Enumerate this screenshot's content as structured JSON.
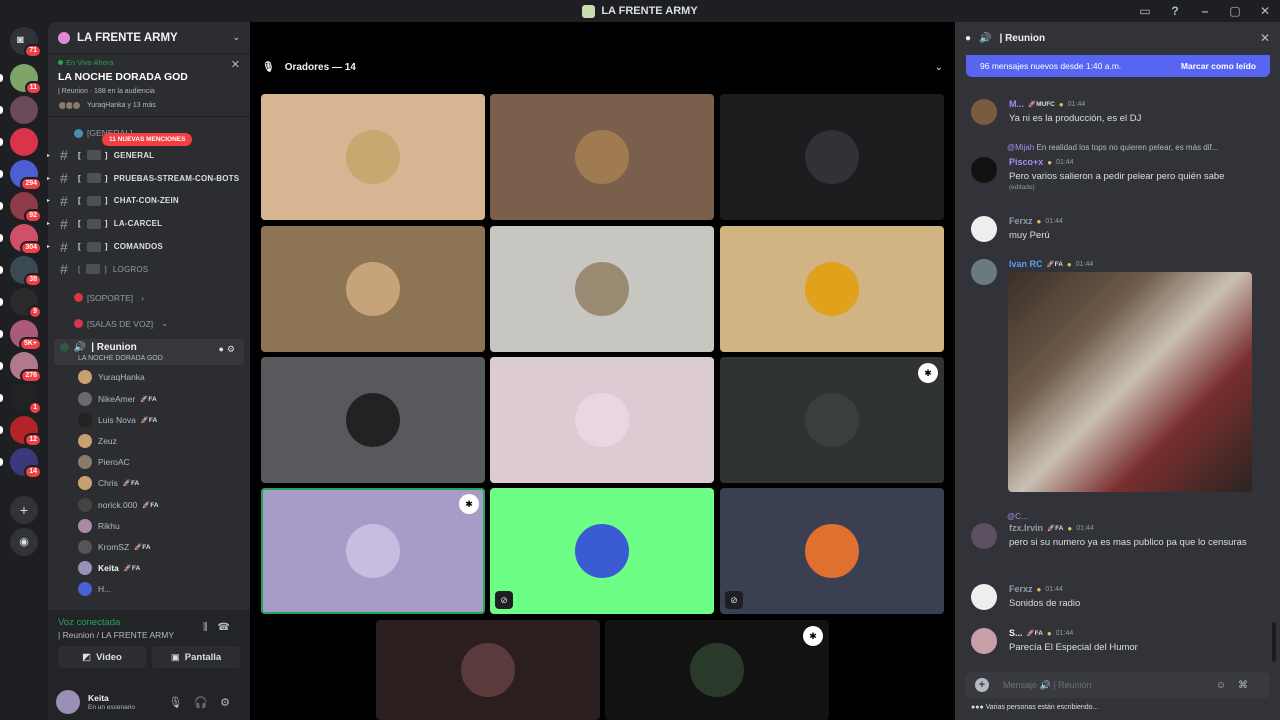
{
  "app": {
    "title": "LA FRENTE ARMY"
  },
  "titlebar": {
    "controls": [
      "inbox-icon",
      "help-icon",
      "minimize",
      "maximize",
      "close"
    ]
  },
  "rail": {
    "home_badge": "71",
    "servers": [
      {
        "badge": "11",
        "color": "#7fa46a"
      },
      {
        "badge": "",
        "color": "#6b4a5a"
      },
      {
        "badge": "",
        "color": "#d8354b"
      },
      {
        "badge": "294",
        "color": "#4a5fd1"
      },
      {
        "badge": "92",
        "color": "#8e3b4a"
      },
      {
        "badge": "304",
        "color": "#d0506a"
      },
      {
        "badge": "38",
        "color": "#3a4a55"
      },
      {
        "badge": "9",
        "color": "#2a2a2a"
      },
      {
        "badge": "5K+",
        "color": "#aa5a7a"
      },
      {
        "badge": "276",
        "color": "#b07a8a"
      },
      {
        "badge": "1",
        "color": "#222"
      },
      {
        "badge": "12",
        "color": "#b3242a"
      },
      {
        "badge": "14",
        "color": "#3a3a7a"
      }
    ]
  },
  "sidebar": {
    "guild_name": "LA FRENTE ARMY",
    "event": {
      "status": "En Vivo Ahora",
      "name": "LA NOCHE DORADA GOD",
      "meta": "| Reunion  ·  188 en la audiencia",
      "users": "YuraqHanka y 13 más"
    },
    "mentions": "11 NUEVAS MENCIONES",
    "category_general": "[GENERAL]",
    "channels": [
      {
        "name": "GENERAL",
        "muted": false
      },
      {
        "name": "PRUEBAS-STREAM-CON-BOTS",
        "muted": false
      },
      {
        "name": "CHAT-CON-ZEIN",
        "muted": false
      },
      {
        "name": "LA-CARCEL",
        "muted": false
      },
      {
        "name": "COMANDOS",
        "muted": false
      },
      {
        "name": "LOGROS",
        "muted": true
      }
    ],
    "category_soporte": "[SOPORTE]",
    "category_voz": "[SALAS DE VOZ]",
    "voice_channel": {
      "name": "| Reunion",
      "sub": "LA NOCHE DORADA GOD"
    },
    "members": [
      {
        "name": "YuraqHanka",
        "tag": "",
        "color": "#c9a070"
      },
      {
        "name": "NikeAmer",
        "tag": "FA",
        "color": "#6a6a6a"
      },
      {
        "name": "Luis Nova",
        "tag": "FA",
        "color": "#222"
      },
      {
        "name": "Zeuz",
        "tag": "",
        "color": "#c9a070"
      },
      {
        "name": "PieroAC",
        "tag": "",
        "color": "#8a7a6a"
      },
      {
        "name": "Chris",
        "tag": "FA",
        "color": "#c9a070"
      },
      {
        "name": "norick.000",
        "tag": "FA",
        "color": "#444"
      },
      {
        "name": "Rikhu",
        "tag": "",
        "color": "#aa8aa0"
      },
      {
        "name": "KromSZ",
        "tag": "FA",
        "color": "#555"
      },
      {
        "name": "Keita",
        "tag": "FA",
        "color": "#9a8fb6"
      },
      {
        "name": "H...",
        "tag": "",
        "color": "#4a5fd1"
      }
    ],
    "voice_panel": {
      "status": "Voz conectada",
      "location": "| Reunion / LA FRENTE ARMY",
      "video": "Video",
      "screen": "Pantalla",
      "user_name": "Keita",
      "user_status": "En un escenario"
    }
  },
  "stage": {
    "header": "Oradores — 14",
    "tiles": [
      {
        "bg": "#d7b492",
        "av": "#c8a870",
        "mic": false,
        "mod": false
      },
      {
        "bg": "#7a5f4d",
        "av": "#a07a50",
        "mic": false,
        "mod": false
      },
      {
        "bg": "#1b1c1e",
        "av": "#303236",
        "mic": false,
        "mod": false
      },
      {
        "bg": "#8c7454",
        "av": "#c7a37a",
        "mic": false,
        "mod": false
      },
      {
        "bg": "#c7c6c0",
        "av": "#9a8a72",
        "mic": false,
        "mod": false
      },
      {
        "bg": "#d2b483",
        "av": "#e0a21a",
        "mic": false,
        "mod": false
      },
      {
        "bg": "#58595c",
        "av": "#222",
        "mic": false,
        "mod": false
      },
      {
        "bg": "#dccbd2",
        "av": "#e8d6e2",
        "mic": false,
        "mod": false
      },
      {
        "bg": "#2f3331",
        "av": "#3a4040",
        "mic": false,
        "mod": true
      },
      {
        "bg": "#a79bc8",
        "av": "#c6bde0",
        "mic": false,
        "mod": true
      },
      {
        "bg": "#6cfe85",
        "av": "#3b5bd3",
        "mic": true,
        "mod": false
      },
      {
        "bg": "#3b3f52",
        "av": "#e07030",
        "mic": true,
        "mod": false
      },
      {
        "bg": "#2a1e1e",
        "av": "#5a3a3a",
        "mic": false,
        "mod": false
      },
      {
        "bg": "#121212",
        "av": "#2a3a2a",
        "mic": false,
        "mod": true
      }
    ]
  },
  "chat": {
    "header": "| Reunion",
    "new_messages": "96 mensajes nuevos desde 1:40 a.m.",
    "mark_read": "Marcar como leído",
    "messages": [
      {
        "name": "M...",
        "name_color": "#a98cf0",
        "tag": "MUFC",
        "time": "01:44",
        "body": "Ya ni es la producción, es el DJ",
        "edited": "",
        "av": "#7a5a40"
      },
      {
        "name": "Pisco+x",
        "name_color": "#a98cf0",
        "tag": "",
        "time": "01:44",
        "body": "Pero varios salieron a pedir pelear pero quién sabe",
        "edited": "(editado)",
        "av": "#111"
      },
      {
        "name": "Ferxz",
        "name_color": "#949ba4",
        "tag": "",
        "time": "01:44",
        "body": "muy Perú",
        "edited": "",
        "av": "#eee"
      },
      {
        "name": "Ivan RC",
        "name_color": "#5aa0f0",
        "tag": "FA",
        "time": "01:44",
        "body": "",
        "edited": "",
        "av": "#6a7a80"
      },
      {
        "name": "fzx.Irvin",
        "name_color": "#949ba4",
        "tag": "FA",
        "time": "01:44",
        "body": "pero si su numero ya es mas publico pa que lo censuras",
        "edited": "",
        "av": "#5a5060"
      },
      {
        "name": "Ferxz",
        "name_color": "#949ba4",
        "tag": "",
        "time": "01:44",
        "body": "Sonidos de radio",
        "edited": "",
        "av": "#eee"
      },
      {
        "name": "S...",
        "name_color": "#f2f3f5",
        "tag": "FA",
        "time": "01:44",
        "body": "Parecía El Especial del Humor",
        "edited": "",
        "av": "#c9a0a8"
      }
    ],
    "reply_pisco": {
      "user": "@Mijah",
      "text": "En realidad los tops no quieren pelear, es más dif..."
    },
    "reply_irvin": {
      "user": "@C..."
    },
    "composer_placeholder": "Mensaje 🔊 | Reunion",
    "typing": "Varias personas están escribiendo..."
  }
}
